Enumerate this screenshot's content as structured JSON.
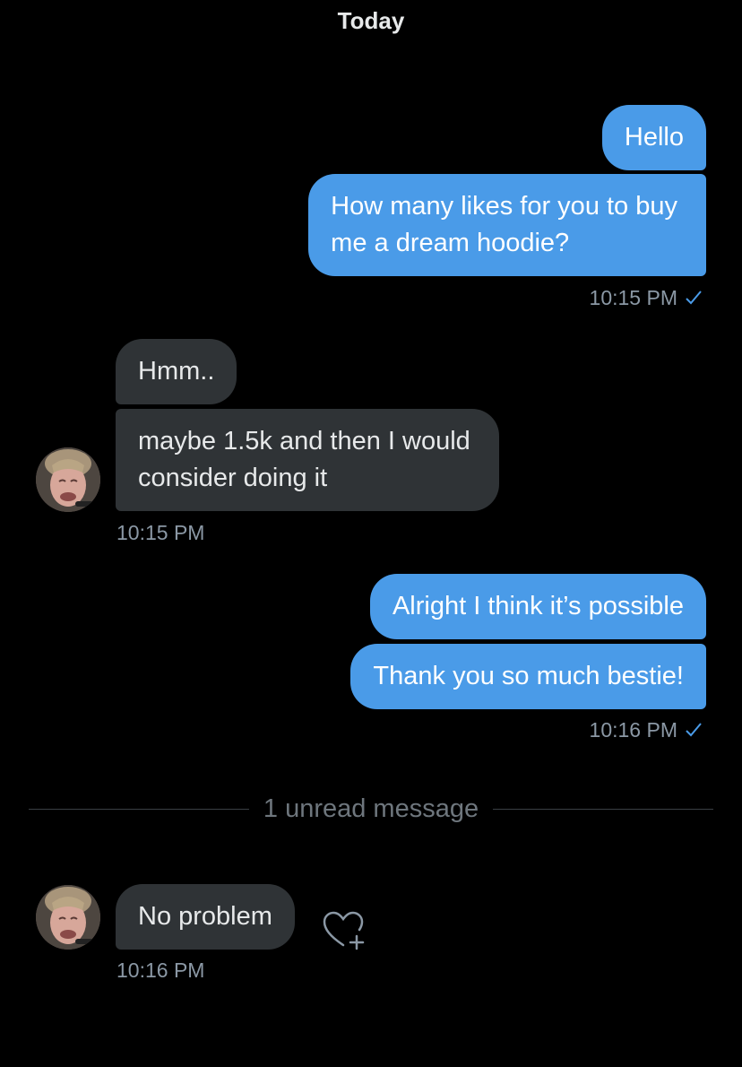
{
  "conversation": {
    "date_header": "Today",
    "messages": [
      {
        "text": "Hello"
      },
      {
        "text_line1": "How many likes for you to buy",
        "text_line2": "me a dream hoodie?",
        "time": "10:15 PM"
      },
      {
        "text": "Hmm.."
      },
      {
        "text_line1": "maybe 1.5k and then I would",
        "text_line2": "consider doing it",
        "time": "10:15 PM"
      },
      {
        "text": "Alright I think it’s possible"
      },
      {
        "text": "Thank you so much bestie!",
        "time": "10:16 PM"
      },
      {
        "text": "No problem",
        "time": "10:16 PM"
      }
    ],
    "unread_divider": "1 unread message"
  },
  "icons": {
    "read_receipt": "check-icon",
    "avatar": "avatar",
    "react": "heart-plus-icon"
  },
  "colors": {
    "background": "#000000",
    "outgoing_bubble": "#4a9be8",
    "incoming_bubble": "#2f3336",
    "timestamp": "#8b98a5",
    "check": "#4a9be8"
  }
}
